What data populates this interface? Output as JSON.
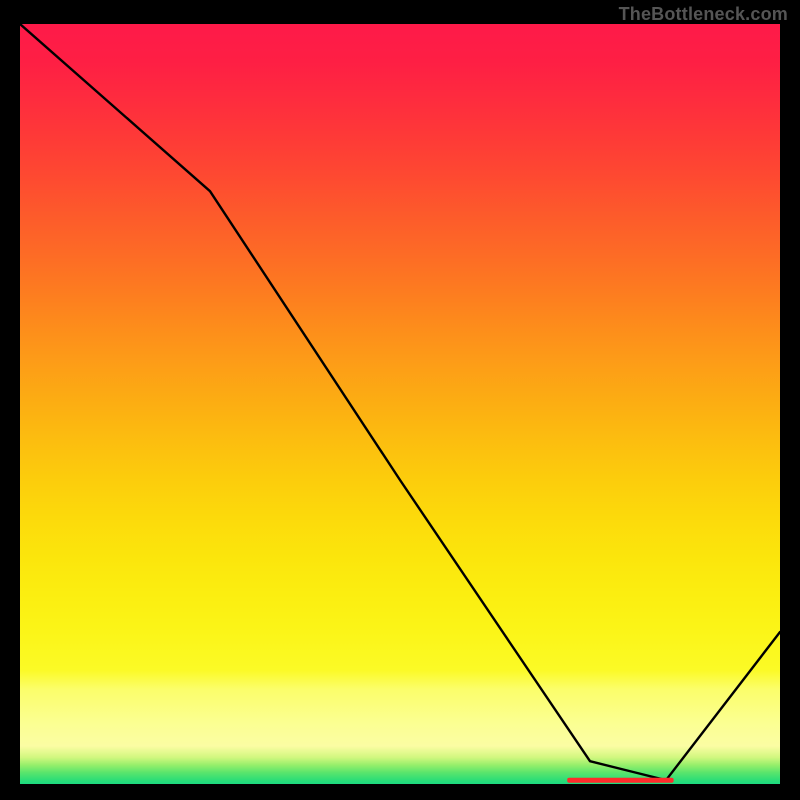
{
  "watermark": "TheBottleneck.com",
  "chart_data": {
    "type": "line",
    "title": "",
    "xlabel": "",
    "ylabel": "",
    "xlim": [
      0,
      100
    ],
    "ylim": [
      0,
      100
    ],
    "grid": false,
    "legend": false,
    "series": [
      {
        "name": "curve",
        "x": [
          0,
          25,
          50,
          75,
          85,
          100
        ],
        "y": [
          100,
          78,
          40,
          3,
          0.5,
          20
        ]
      }
    ],
    "background_gradient": {
      "stops": [
        {
          "pos": 0.0,
          "color": "#fe1a49"
        },
        {
          "pos": 0.05,
          "color": "#fe1f44"
        },
        {
          "pos": 0.1,
          "color": "#fe2c3e"
        },
        {
          "pos": 0.15,
          "color": "#fe3a37"
        },
        {
          "pos": 0.2,
          "color": "#fe4931"
        },
        {
          "pos": 0.25,
          "color": "#fd5a2b"
        },
        {
          "pos": 0.3,
          "color": "#fd6a26"
        },
        {
          "pos": 0.35,
          "color": "#fd7b20"
        },
        {
          "pos": 0.4,
          "color": "#fd8d1b"
        },
        {
          "pos": 0.45,
          "color": "#fd9e17"
        },
        {
          "pos": 0.5,
          "color": "#fcae12"
        },
        {
          "pos": 0.55,
          "color": "#fcbe0f"
        },
        {
          "pos": 0.6,
          "color": "#fccd0c"
        },
        {
          "pos": 0.65,
          "color": "#fcda0b"
        },
        {
          "pos": 0.7,
          "color": "#fbe50c"
        },
        {
          "pos": 0.75,
          "color": "#fbee10"
        },
        {
          "pos": 0.8,
          "color": "#fbf518"
        },
        {
          "pos": 0.85,
          "color": "#fbfa26"
        },
        {
          "pos": 0.875,
          "color": "#fbfe6a"
        },
        {
          "pos": 0.92,
          "color": "#fbff92"
        },
        {
          "pos": 0.95,
          "color": "#fbfda3"
        },
        {
          "pos": 0.965,
          "color": "#d1f77f"
        },
        {
          "pos": 0.975,
          "color": "#96ef6b"
        },
        {
          "pos": 0.985,
          "color": "#59e56c"
        },
        {
          "pos": 0.995,
          "color": "#2cdd77"
        },
        {
          "pos": 1.0,
          "color": "#1cda80"
        }
      ]
    },
    "marker_bar": {
      "color": "#ff2a2a",
      "x_start": 72,
      "x_end": 86,
      "y": 0.5,
      "label": ""
    }
  }
}
